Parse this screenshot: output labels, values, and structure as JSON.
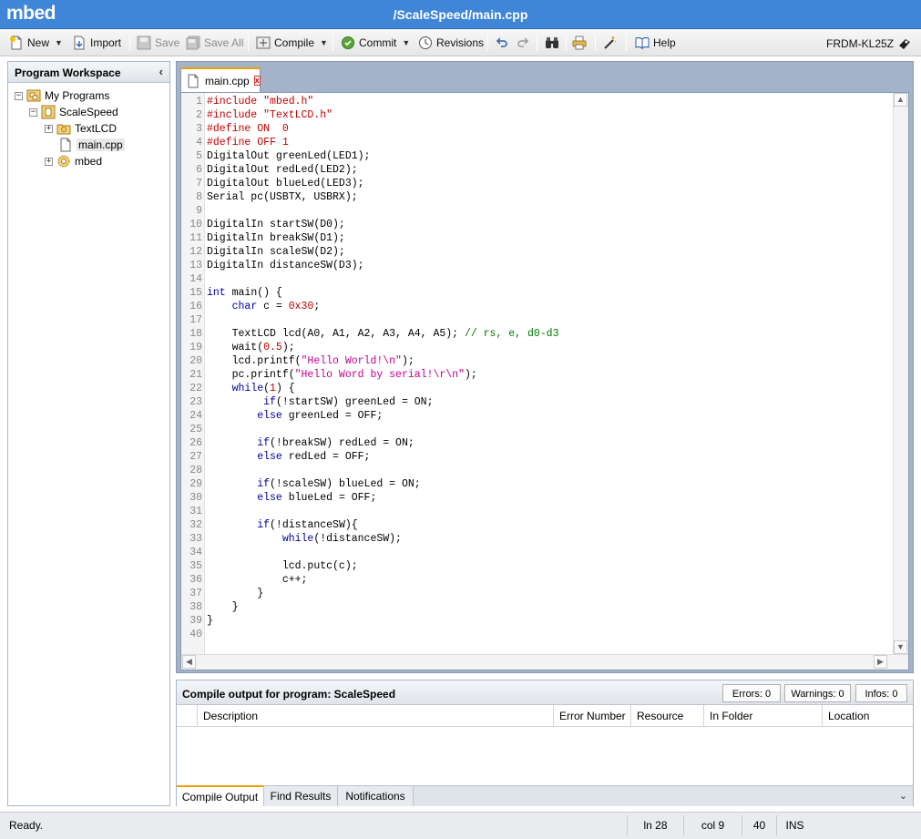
{
  "app": {
    "logo": "mbed",
    "path": "/ScaleSpeed/main.cpp"
  },
  "toolbar": {
    "new": "New",
    "import": "Import",
    "save": "Save",
    "save_all": "Save All",
    "compile": "Compile",
    "commit": "Commit",
    "revisions": "Revisions",
    "help": "Help",
    "device": "FRDM-KL25Z"
  },
  "workspace": {
    "title": "Program Workspace",
    "tree": {
      "root": "My Programs",
      "program": "ScaleSpeed",
      "lib1": "TextLCD",
      "file": "main.cpp",
      "lib2": "mbed"
    }
  },
  "editor": {
    "tab_label": "main.cpp",
    "tab_close": "x",
    "lines": [
      [
        {
          "t": "#include \"mbed.h\"",
          "c": "pp"
        }
      ],
      [
        {
          "t": "#include \"TextLCD.h\"",
          "c": "pp"
        }
      ],
      [
        {
          "t": "#define ON  0",
          "c": "pp"
        }
      ],
      [
        {
          "t": "#define OFF 1",
          "c": "pp"
        }
      ],
      [
        {
          "t": "DigitalOut greenLed(LED1);",
          "c": "plain"
        }
      ],
      [
        {
          "t": "DigitalOut redLed(LED2);",
          "c": "plain"
        }
      ],
      [
        {
          "t": "DigitalOut blueLed(LED3);",
          "c": "plain"
        }
      ],
      [
        {
          "t": "Serial pc(USBTX, USBRX);",
          "c": "plain"
        }
      ],
      [],
      [
        {
          "t": "DigitalIn startSW(D0);",
          "c": "plain"
        }
      ],
      [
        {
          "t": "DigitalIn breakSW(D1);",
          "c": "plain"
        }
      ],
      [
        {
          "t": "DigitalIn scaleSW(D2);",
          "c": "plain"
        }
      ],
      [
        {
          "t": "DigitalIn distanceSW(D3);",
          "c": "plain"
        }
      ],
      [],
      [
        {
          "t": "int",
          "c": "kw"
        },
        {
          "t": " main() {",
          "c": "plain"
        }
      ],
      [
        {
          "t": "    ",
          "c": "plain"
        },
        {
          "t": "char",
          "c": "kw"
        },
        {
          "t": " c = ",
          "c": "plain"
        },
        {
          "t": "0x30",
          "c": "num"
        },
        {
          "t": ";",
          "c": "plain"
        }
      ],
      [],
      [
        {
          "t": "    TextLCD lcd(A0, A1, A2, A3, A4, A5); ",
          "c": "plain"
        },
        {
          "t": "// rs, e, d0-d3",
          "c": "cm"
        }
      ],
      [
        {
          "t": "    wait(",
          "c": "plain"
        },
        {
          "t": "0.5",
          "c": "num"
        },
        {
          "t": ");",
          "c": "plain"
        }
      ],
      [
        {
          "t": "    lcd.printf(",
          "c": "plain"
        },
        {
          "t": "\"Hello World!\\n\"",
          "c": "str"
        },
        {
          "t": ");",
          "c": "plain"
        }
      ],
      [
        {
          "t": "    pc.printf(",
          "c": "plain"
        },
        {
          "t": "\"Hello Word by serial!\\r\\n\"",
          "c": "str"
        },
        {
          "t": ");",
          "c": "plain"
        }
      ],
      [
        {
          "t": "    ",
          "c": "plain"
        },
        {
          "t": "while",
          "c": "kw"
        },
        {
          "t": "(",
          "c": "plain"
        },
        {
          "t": "1",
          "c": "num"
        },
        {
          "t": ") {",
          "c": "plain"
        }
      ],
      [
        {
          "t": "         ",
          "c": "plain"
        },
        {
          "t": "if",
          "c": "kw"
        },
        {
          "t": "(!startSW) greenLed = ON;",
          "c": "plain"
        }
      ],
      [
        {
          "t": "        ",
          "c": "plain"
        },
        {
          "t": "else",
          "c": "kw"
        },
        {
          "t": " greenLed = OFF;",
          "c": "plain"
        }
      ],
      [],
      [
        {
          "t": "        ",
          "c": "plain"
        },
        {
          "t": "if",
          "c": "kw"
        },
        {
          "t": "(!breakSW) redLed = ON;",
          "c": "plain"
        }
      ],
      [
        {
          "t": "        ",
          "c": "plain"
        },
        {
          "t": "else",
          "c": "kw"
        },
        {
          "t": " redLed = OFF;",
          "c": "plain"
        }
      ],
      [],
      [
        {
          "t": "        ",
          "c": "plain"
        },
        {
          "t": "if",
          "c": "kw"
        },
        {
          "t": "(!scaleSW) blueLed = ON;",
          "c": "plain"
        }
      ],
      [
        {
          "t": "        ",
          "c": "plain"
        },
        {
          "t": "else",
          "c": "kw"
        },
        {
          "t": " blueLed = OFF;",
          "c": "plain"
        }
      ],
      [],
      [
        {
          "t": "        ",
          "c": "plain"
        },
        {
          "t": "if",
          "c": "kw"
        },
        {
          "t": "(!distanceSW){",
          "c": "plain"
        }
      ],
      [
        {
          "t": "            ",
          "c": "plain"
        },
        {
          "t": "while",
          "c": "kw"
        },
        {
          "t": "(!distanceSW);",
          "c": "plain"
        }
      ],
      [],
      [
        {
          "t": "            lcd.putc(c);",
          "c": "plain"
        }
      ],
      [
        {
          "t": "            c++;",
          "c": "plain"
        }
      ],
      [
        {
          "t": "        }",
          "c": "plain"
        }
      ],
      [
        {
          "t": "    }",
          "c": "plain"
        }
      ],
      [
        {
          "t": "}",
          "c": "plain"
        }
      ],
      []
    ]
  },
  "output": {
    "title": "Compile output for program: ScaleSpeed",
    "errors": "Errors: 0",
    "warnings": "Warnings: 0",
    "infos": "Infos: 0",
    "columns": [
      "Description",
      "Error Number",
      "Resource",
      "In Folder",
      "Location"
    ],
    "tabs": [
      "Compile Output",
      "Find Results",
      "Notifications"
    ]
  },
  "status": {
    "text": "Ready.",
    "line": "ln 28",
    "col": "col 9",
    "total": "40",
    "mode": "INS"
  },
  "colors": {
    "titlebar": "#3f85d8",
    "preprocessor": "#c00000",
    "keyword": "#00009f",
    "string": "#c4008f",
    "comment": "#007800",
    "tab_accent": "#f0a000"
  }
}
